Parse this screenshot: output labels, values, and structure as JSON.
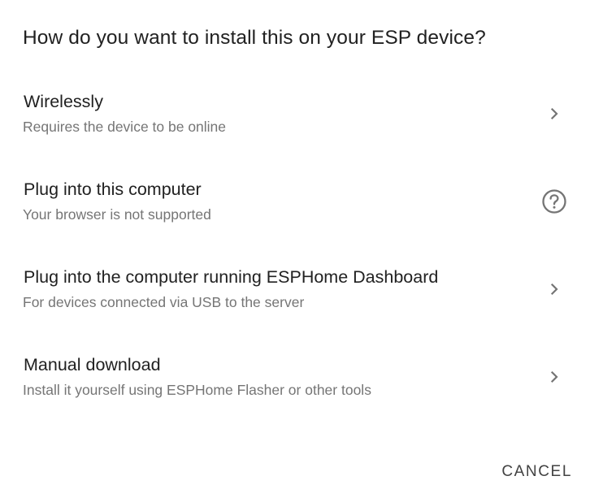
{
  "dialog": {
    "title": "How do you want to install this on your ESP device?",
    "options": [
      {
        "label": "Wirelessly",
        "description": "Requires the device to be online",
        "icon": "chevron-right-icon"
      },
      {
        "label": "Plug into this computer",
        "description": "Your browser is not supported",
        "icon": "help-circle-icon"
      },
      {
        "label": "Plug into the computer running ESPHome Dashboard",
        "description": "For devices connected via USB to the server",
        "icon": "chevron-right-icon"
      },
      {
        "label": "Manual download",
        "description": "Install it yourself using ESPHome Flasher or other tools",
        "icon": "chevron-right-icon"
      }
    ],
    "cancel_label": "CANCEL"
  },
  "colors": {
    "primary_text": "#212121",
    "secondary_text": "#757575",
    "icon": "#757575",
    "background": "#ffffff"
  }
}
